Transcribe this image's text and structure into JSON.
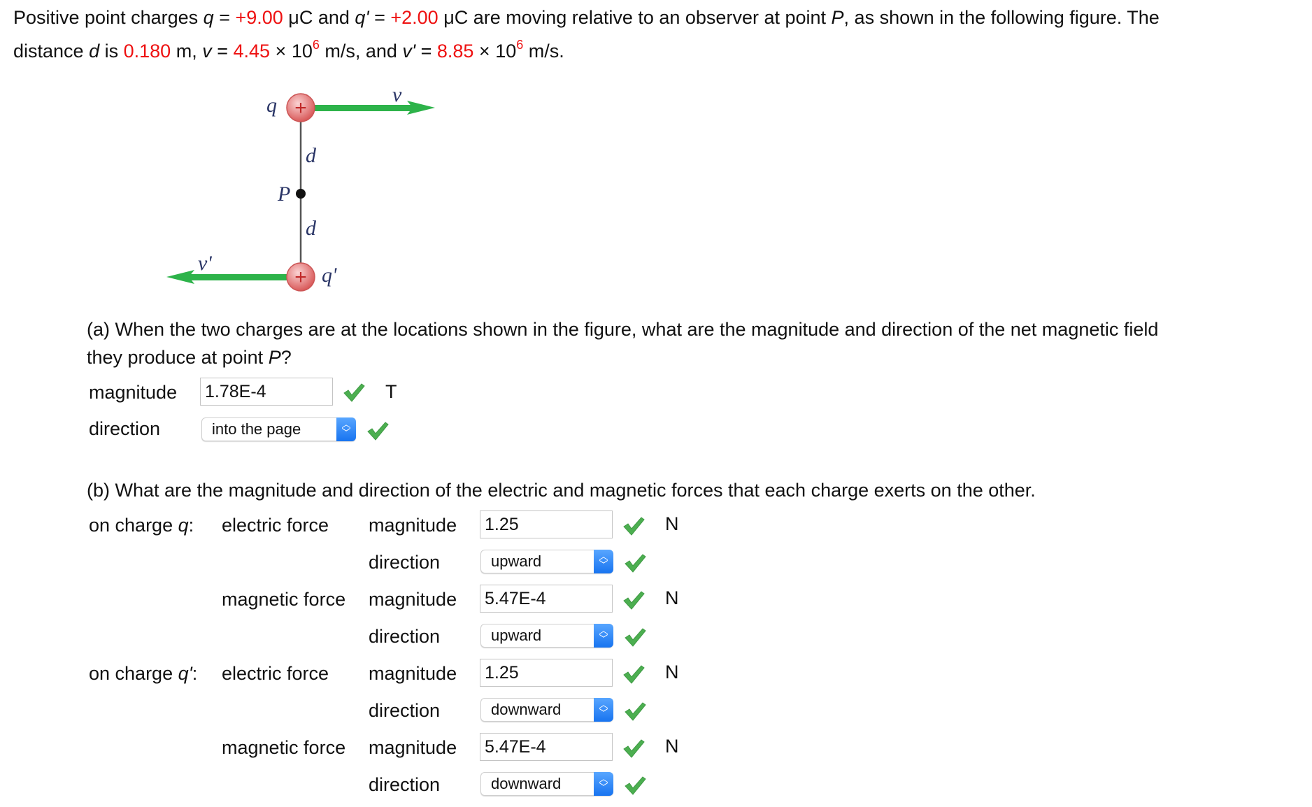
{
  "problem": {
    "line1": {
      "t1": "Positive point charges ",
      "q": "q",
      "t2": " = ",
      "qval": "+9.00",
      "t3": " μC and ",
      "qp": "q'",
      "t4": " = ",
      "qpval": "+2.00",
      "t5": " μC are moving relative to an observer at point ",
      "P": "P",
      "t6": ", as shown in the following figure. The"
    },
    "line2": {
      "t1": "distance ",
      "d": "d",
      "t2": " is ",
      "dval": "0.180",
      "t3": " m, ",
      "v": "v",
      "t4": " = ",
      "vval": "4.45",
      "t5": " × 10",
      "exp1": "6",
      "t6": " m/s, and ",
      "vp": "v'",
      "t7": " = ",
      "vpval": "8.85",
      "t8": " × 10",
      "exp2": "6",
      "t9": " m/s."
    }
  },
  "figure": {
    "q": "q",
    "qp": "q'",
    "v": "v",
    "vp": "v'",
    "P": "P",
    "d1": "d",
    "d2": "d",
    "plus": "+",
    "arrow_color": "#2db34a",
    "charge_color": "#e06a6a"
  },
  "part_a": {
    "question_line1": "(a) When the two charges are at the locations shown in the figure, what are the magnitude and direction of the net magnetic field",
    "question_line2a": "they produce at point ",
    "question_line2P": "P",
    "question_line2b": "?",
    "magnitude_label": "magnitude",
    "magnitude_value": "1.78E-4",
    "magnitude_unit": "T",
    "direction_label": "direction",
    "direction_value": "into the page"
  },
  "part_b": {
    "question": "(b) What are the magnitude and direction of the electric and magnetic forces that each charge exerts on the other.",
    "rows": [
      {
        "c1": "on charge ",
        "c1i": "q",
        "c1s": ":",
        "c2": "electric force",
        "c3": "magnitude",
        "type": "input",
        "value": "1.25",
        "unit": "N"
      },
      {
        "c1": "",
        "c1i": "",
        "c1s": "",
        "c2": "",
        "c3": "direction",
        "type": "select",
        "value": "upward",
        "unit": ""
      },
      {
        "c1": "",
        "c1i": "",
        "c1s": "",
        "c2": "magnetic force",
        "c3": "magnitude",
        "type": "input",
        "value": "5.47E-4",
        "unit": "N"
      },
      {
        "c1": "",
        "c1i": "",
        "c1s": "",
        "c2": "",
        "c3": "direction",
        "type": "select",
        "value": "upward",
        "unit": ""
      },
      {
        "c1": "on charge ",
        "c1i": "q'",
        "c1s": ":",
        "c2": "electric force",
        "c3": "magnitude",
        "type": "input",
        "value": "1.25",
        "unit": "N"
      },
      {
        "c1": "",
        "c1i": "",
        "c1s": "",
        "c2": "",
        "c3": "direction",
        "type": "select",
        "value": "downward",
        "unit": ""
      },
      {
        "c1": "",
        "c1i": "",
        "c1s": "",
        "c2": "magnetic force",
        "c3": "magnitude",
        "type": "input",
        "value": "5.47E-4",
        "unit": "N"
      },
      {
        "c1": "",
        "c1i": "",
        "c1s": "",
        "c2": "",
        "c3": "direction",
        "type": "select",
        "value": "downward",
        "unit": ""
      }
    ]
  },
  "icons": {
    "correct": "checkmark-icon",
    "select": "updown-chevron-icon"
  },
  "colors": {
    "given_values": "#ee1111",
    "check": "#4caf50",
    "select_button": "#1874f0"
  }
}
